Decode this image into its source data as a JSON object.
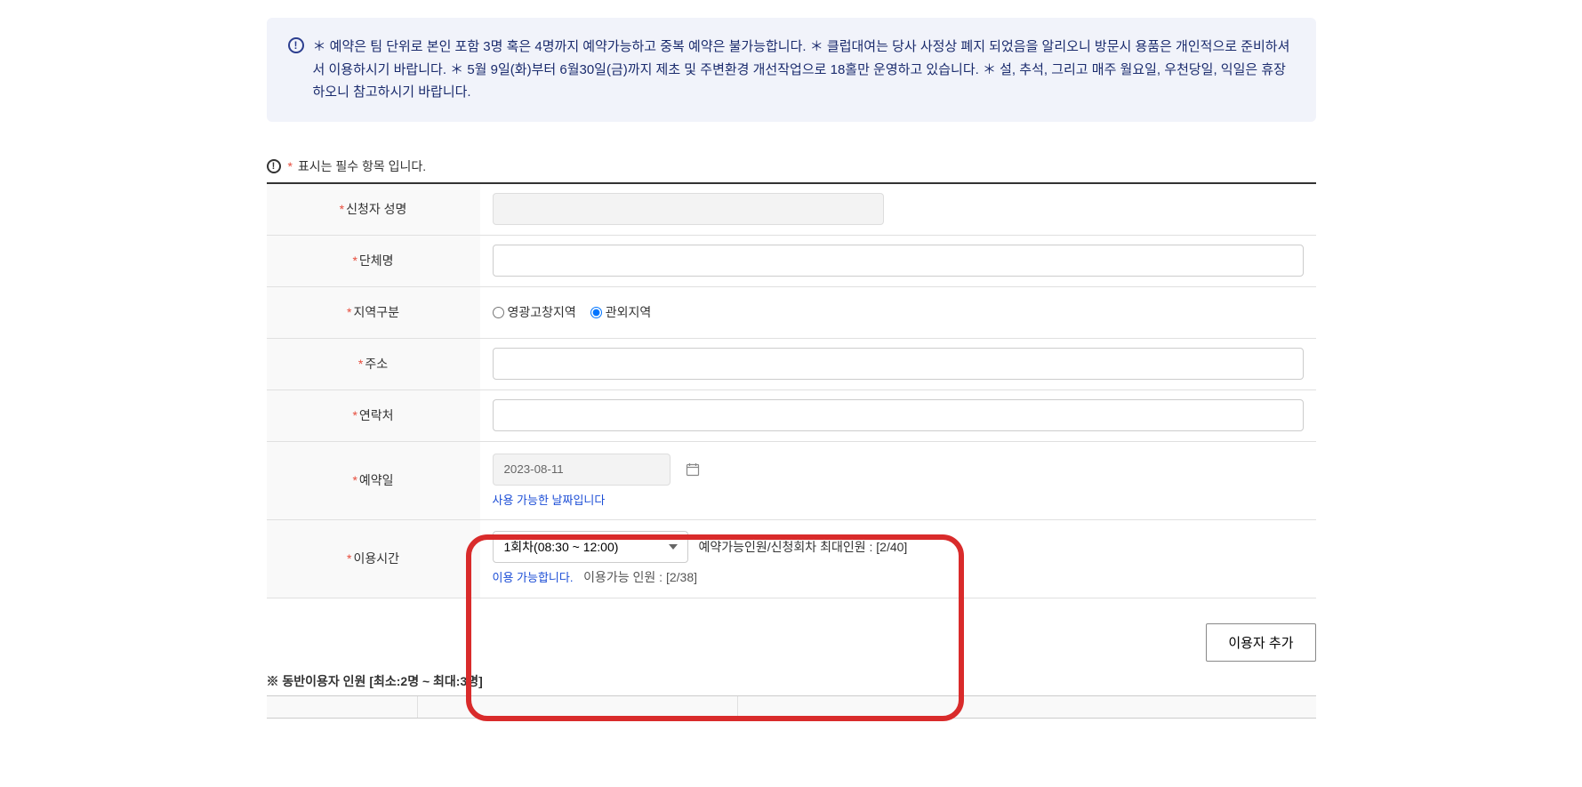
{
  "notice": {
    "text": "＊ 예약은 팀 단위로 본인 포함 3명 혹은 4명까지 예약가능하고 중복 예약은 불가능합니다. ＊ 클럽대여는 당사 사정상 폐지 되었음을 알리오니 방문시 용품은 개인적으로 준비하셔서 이용하시기 바랍니다. ＊ 5월 9일(화)부터 6월30일(금)까지 제초 및 주변환경 개선작업으로 18홀만 운영하고 있습니다. ＊ 설, 추석, 그리고 매주 월요일, 우천당일, 익일은 휴장하오니 참고하시기 바랍니다."
  },
  "required_note": {
    "star": "*",
    "text": "표시는 필수 항목 입니다."
  },
  "form": {
    "applicant_name": {
      "label": "신청자 성명",
      "value": ""
    },
    "group_name": {
      "label": "단체명",
      "value": ""
    },
    "region": {
      "label": "지역구분",
      "options": {
        "opt1": "영광고창지역",
        "opt2": "관외지역"
      },
      "selected": "opt2"
    },
    "address": {
      "label": "주소",
      "value": ""
    },
    "phone": {
      "label": "연락처",
      "value": ""
    },
    "date": {
      "label": "예약일",
      "value": "2023-08-11",
      "helper": "사용 가능한 날짜입니다"
    },
    "time": {
      "label": "이용시간",
      "selected": "1회차(08:30 ~ 12:00)",
      "capacity_label": "예약가능인원/신청회차 최대인원 : [2/40]",
      "helper_status": "이용 가능합니다.",
      "helper_count": "이용가능 인원 : [2/38]"
    }
  },
  "buttons": {
    "add_user": "이용자 추가"
  },
  "sub_section": {
    "title": "※ 동반이용자 인원 [최소:2명 ~ 최대:3명]"
  }
}
